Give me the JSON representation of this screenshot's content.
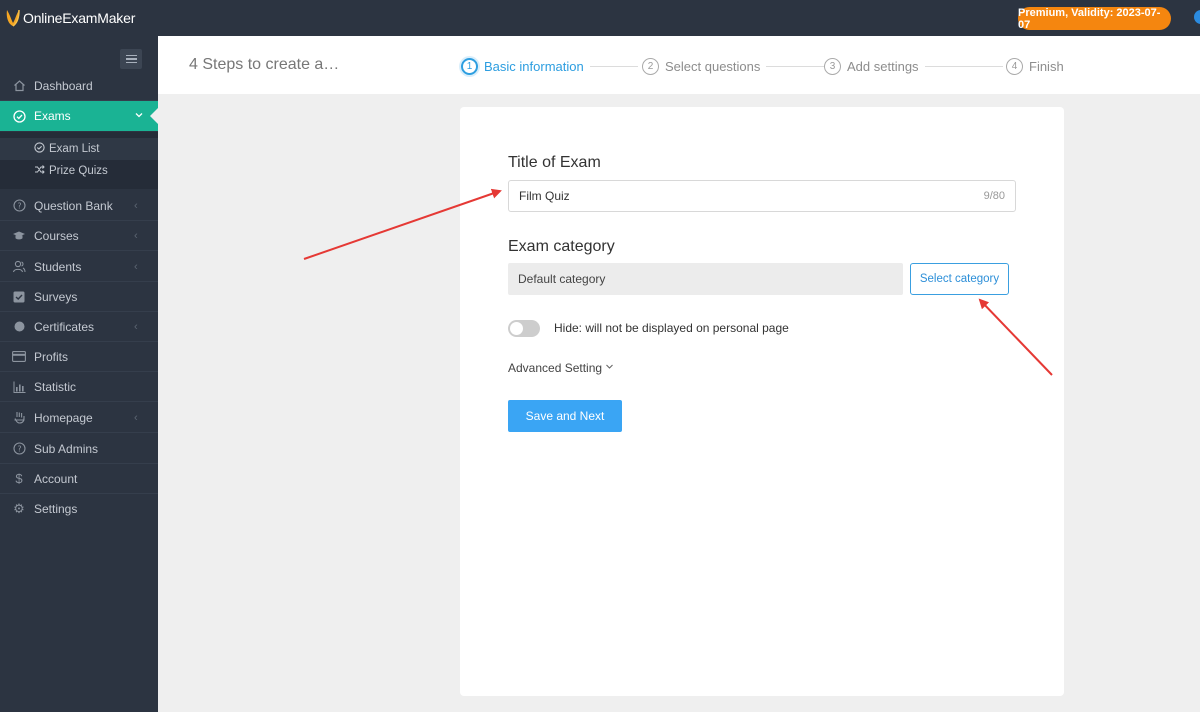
{
  "app": {
    "logo_text": "OnlineExamMaker",
    "premium_badge": "Premium, Validity: 2023-07-07"
  },
  "sidebar": {
    "items": [
      {
        "label": "Dashboard",
        "icon": "home-icon",
        "chevron": false
      },
      {
        "label": "Exams",
        "icon": "check-circle-icon",
        "chevron": true,
        "active": true
      },
      {
        "label": "Question Bank",
        "icon": "question-circle-icon",
        "chevron": true
      },
      {
        "label": "Courses",
        "icon": "graduation-cap-icon",
        "chevron": true
      },
      {
        "label": "Students",
        "icon": "users-icon",
        "chevron": true
      },
      {
        "label": "Surveys",
        "icon": "checkbox-icon",
        "chevron": false
      },
      {
        "label": "Certificates",
        "icon": "circle-icon",
        "chevron": true
      },
      {
        "label": "Profits",
        "icon": "credit-card-icon",
        "chevron": false
      },
      {
        "label": "Statistic",
        "icon": "bar-chart-icon",
        "chevron": false
      },
      {
        "label": "Homepage",
        "icon": "hand-icon",
        "chevron": true
      },
      {
        "label": "Sub Admins",
        "icon": "question-circle-icon",
        "chevron": false
      },
      {
        "label": "Account",
        "icon": "dollar-icon",
        "chevron": false
      },
      {
        "label": "Settings",
        "icon": "gear-icon",
        "chevron": false
      }
    ],
    "subitems": [
      {
        "label": "Exam List",
        "icon": "check-circle-icon"
      },
      {
        "label": "Prize Quizs",
        "icon": "shuffle-icon"
      }
    ]
  },
  "header": {
    "title": "4 Steps to create a…",
    "steps": [
      {
        "num": "1",
        "label": "Basic information",
        "active": true
      },
      {
        "num": "2",
        "label": "Select questions"
      },
      {
        "num": "3",
        "label": "Add settings"
      },
      {
        "num": "4",
        "label": "Finish"
      }
    ]
  },
  "form": {
    "title_label": "Title of Exam",
    "title_value": "Film Quiz",
    "title_count": "9/80",
    "category_label": "Exam category",
    "category_value": "Default category",
    "select_category_button": "Select category",
    "hide_toggle_on": false,
    "hide_label": "Hide: will not be displayed on personal page",
    "advanced_setting": "Advanced Setting",
    "save_button": "Save and Next"
  },
  "colors": {
    "sidebar_bg": "#2c3441",
    "active_green": "#1ab394",
    "accent_blue": "#2d9ee0",
    "premium_orange": "#f5860f",
    "annotation_red": "#e53935"
  }
}
